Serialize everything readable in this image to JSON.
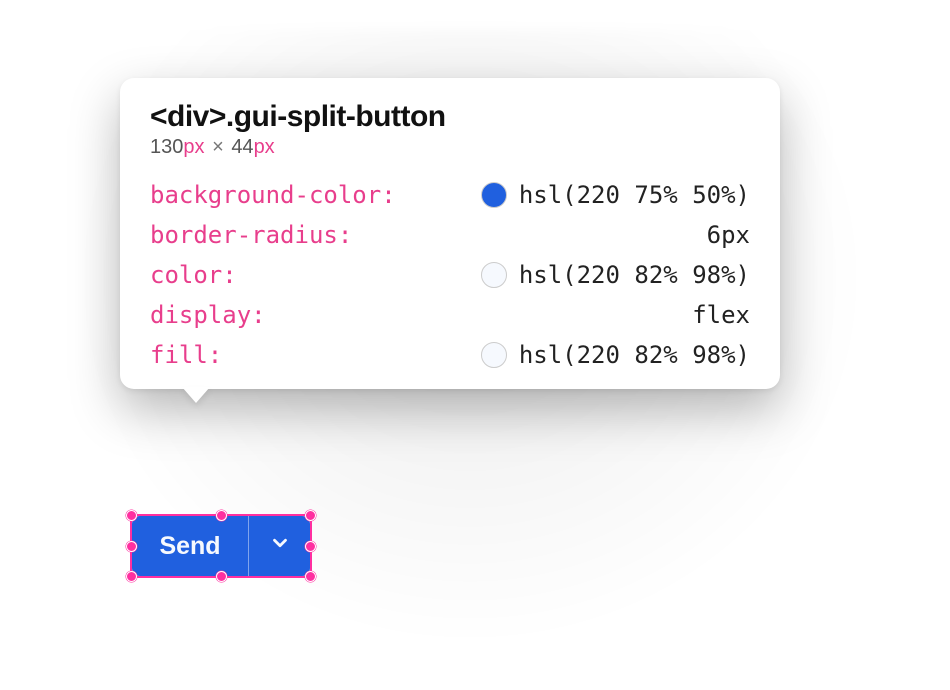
{
  "tooltip": {
    "selector": "<div>.gui-split-button",
    "dims": {
      "w": "130",
      "wunit": "px",
      "sep": "×",
      "h": "44",
      "hunit": "px"
    },
    "props": [
      {
        "name": "background-color:",
        "swatch": "hsl(220 75% 50%)",
        "value": "hsl(220 75% 50%)"
      },
      {
        "name": "border-radius:",
        "swatch": null,
        "value": "6px"
      },
      {
        "name": "color:",
        "swatch": "hsl(220 82% 98%)",
        "value": "hsl(220 82% 98%)"
      },
      {
        "name": "display:",
        "swatch": null,
        "value": "flex"
      },
      {
        "name": "fill:",
        "swatch": "hsl(220 82% 98%)",
        "value": "hsl(220 82% 98%)"
      }
    ]
  },
  "button": {
    "label": "Send",
    "bg": "hsl(220 75% 50%)",
    "fg": "hsl(220 82% 98%)"
  }
}
